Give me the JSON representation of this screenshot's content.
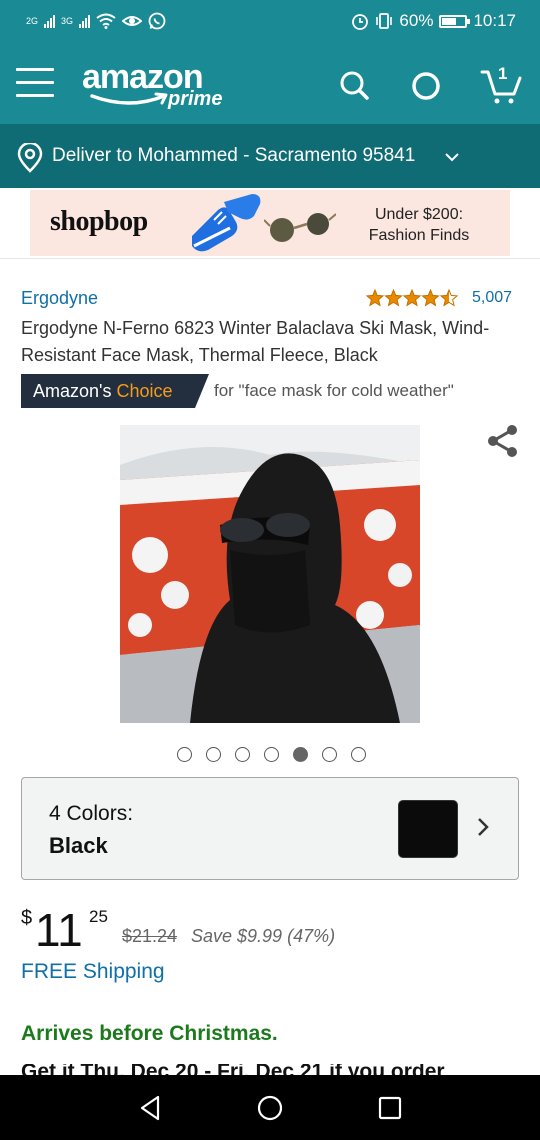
{
  "status_bar": {
    "network_1": "2G",
    "network_2": "3G",
    "battery": "60%",
    "time": "10:17",
    "icons": [
      "signal-icon",
      "wifi-icon",
      "eye-comfort-icon",
      "whatsapp-icon",
      "alarm-icon",
      "vibrate-icon",
      "battery-icon"
    ]
  },
  "header": {
    "logo_word": "amazon",
    "logo_sub": "prime",
    "cart_count": "1",
    "icons": [
      "menu-icon",
      "search-icon",
      "alexa-icon",
      "cart-icon"
    ]
  },
  "delivery": {
    "text": "Deliver to Mohammed - Sacramento 95841"
  },
  "ad": {
    "brand": "shopbop",
    "line1": "Under $200:",
    "line2": "Fashion Finds"
  },
  "product": {
    "brand": "Ergodyne",
    "rating": 4.5,
    "rating_count": "5,007",
    "title": "Ergodyne N-Ferno 6823 Winter Balaclava Ski Mask, Wind-Resistant Face Mask, Thermal Fleece, Black",
    "badge_prefix": "Amazon's",
    "badge_highlight": "Choice",
    "badge_query": "for \"face mask for cold weather\"",
    "image_count": 7,
    "image_active": 5
  },
  "color": {
    "label": "4 Colors:",
    "value": "Black",
    "swatch": "#0b0b0b"
  },
  "price": {
    "symbol": "$",
    "whole": "11",
    "fraction": "25",
    "list": "$21.24",
    "save": "Save $9.99 (47%)"
  },
  "shipping": "FREE Shipping",
  "arrives": "Arrives before Christmas.",
  "cut_off_text": "Get it Thu, Dec 20 - Fri, Dec 21 if you order",
  "colors": {
    "teal_header": "#1a8a94",
    "teal_dark": "#0f6b74",
    "link": "#0f6fa7",
    "green": "#1c7a1c",
    "star": "#e88a00",
    "choice_orange": "#f69c1b"
  }
}
